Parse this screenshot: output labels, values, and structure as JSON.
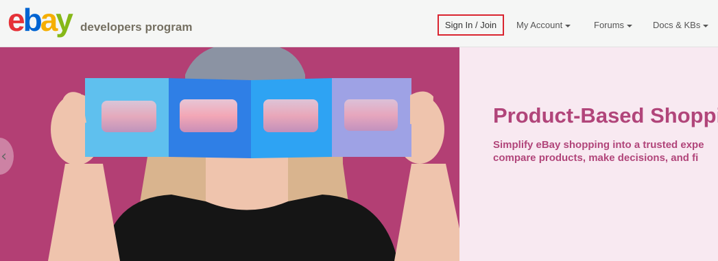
{
  "header": {
    "logo": {
      "letters": [
        "e",
        "b",
        "a",
        "y"
      ],
      "colors": [
        "#e53238",
        "#0064d2",
        "#f5af02",
        "#86b817"
      ]
    },
    "brand_subtitle": "developers program",
    "nav": {
      "signin_label": "Sign In / Join",
      "signin_outline_color": "#d9232e",
      "my_account_label": "My Account",
      "forums_label": "Forums",
      "docs_label": "Docs & KBs"
    }
  },
  "hero": {
    "title": "Product-Based Shoppi",
    "text_line1": "Simplify eBay shopping into a trusted expe",
    "text_line2": "compare products, make decisions, and fi",
    "accent_color": "#b1457a",
    "image_bg_color": "#b33f74",
    "panel_bg_color": "#f8e9f1",
    "prev_icon": "chevron-left-icon"
  }
}
